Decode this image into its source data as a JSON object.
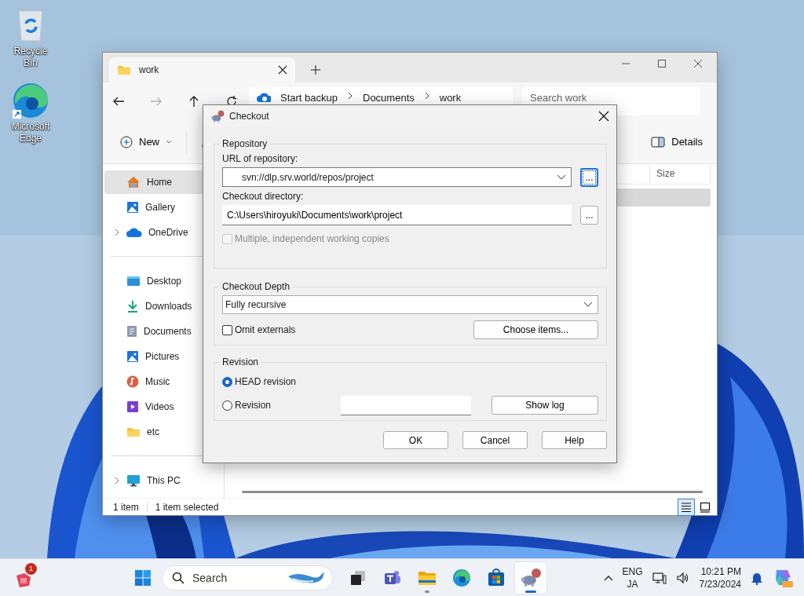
{
  "desktop_icons": [
    {
      "kind": "recycle",
      "label": "Recycle Bin"
    },
    {
      "kind": "edge",
      "label": "Microsoft Edge"
    }
  ],
  "explorer": {
    "tabs": [
      {
        "label": "work",
        "selected": true
      }
    ],
    "nav_buttons": [
      {
        "kind": "back",
        "disabled": false
      },
      {
        "kind": "forward",
        "disabled": true
      },
      {
        "kind": "up",
        "disabled": false
      },
      {
        "kind": "refresh",
        "disabled": false
      }
    ],
    "breadcrumb": [
      "Start backup",
      "Documents",
      "work"
    ],
    "search": {
      "placeholder": "Search work"
    },
    "toolbar": {
      "new": "New",
      "details": "Details"
    },
    "columns": [
      "Size"
    ],
    "files": [
      {
        "selected": true
      }
    ],
    "sidebar": [
      [
        {
          "kind": "home",
          "label": "Home",
          "selected": true,
          "expandable": false
        },
        {
          "kind": "gallery",
          "label": "Gallery",
          "selected": false,
          "expandable": false
        },
        {
          "kind": "onedrive",
          "label": "OneDrive",
          "selected": false,
          "expandable": true
        }
      ],
      [
        {
          "kind": "desktop",
          "label": "Desktop",
          "selected": false,
          "expandable": false
        },
        {
          "kind": "downloads",
          "label": "Downloads",
          "selected": false,
          "expandable": false
        },
        {
          "kind": "documents",
          "label": "Documents",
          "selected": false,
          "expandable": false
        },
        {
          "kind": "pictures",
          "label": "Pictures",
          "selected": false,
          "expandable": false
        },
        {
          "kind": "music",
          "label": "Music",
          "selected": false,
          "expandable": false
        },
        {
          "kind": "videos",
          "label": "Videos",
          "selected": false,
          "expandable": false
        },
        {
          "kind": "folder",
          "label": "etc",
          "selected": false,
          "expandable": false
        }
      ],
      [
        {
          "kind": "thispc",
          "label": "This PC",
          "selected": false,
          "expandable": true
        }
      ]
    ],
    "status_bar": [
      "1 item",
      "1 item selected"
    ],
    "views": [
      {
        "kind": "details",
        "selected": true
      },
      {
        "kind": "tiles",
        "selected": false
      }
    ]
  },
  "dialog": {
    "title": "Checkout",
    "repository": {
      "label": "Repository",
      "url_label": "URL of repository:",
      "url": "svn://dlp.srv.world/repos/project",
      "url_browse": {
        "label": "...",
        "focused": true
      },
      "dir_label": "Checkout directory:",
      "dir": "C:\\Users\\hiroyuki\\Documents\\work\\project",
      "dir_browse": {
        "label": "...",
        "focused": false
      },
      "multiple": {
        "label": "Multiple, independent working copies",
        "checked": false,
        "disabled": true
      }
    },
    "depth": {
      "label": "Checkout Depth",
      "value": "Fully recursive",
      "omit": {
        "label": "Omit externals",
        "checked": false,
        "disabled": false
      },
      "choose": "Choose items..."
    },
    "revision": {
      "label": "Revision",
      "options": [
        {
          "label": "HEAD revision",
          "selected": true
        },
        {
          "label": "Revision",
          "selected": false
        }
      ],
      "show_log": "Show log"
    },
    "buttons": [
      "OK",
      "Cancel",
      "Help"
    ]
  },
  "taskbar": {
    "widget_badge": "1",
    "search_placeholder": "Search",
    "apps": [
      {
        "kind": "taskview",
        "open": false,
        "active": false
      },
      {
        "kind": "teams",
        "open": false,
        "active": false
      },
      {
        "kind": "explorer",
        "open": true,
        "active": false
      },
      {
        "kind": "edge",
        "open": false,
        "active": false
      },
      {
        "kind": "store",
        "open": false,
        "active": false
      },
      {
        "kind": "tortoise",
        "open": true,
        "active": true
      }
    ],
    "language": [
      "ENG",
      "JA"
    ],
    "time": "10:21 PM",
    "date": "7/23/2024"
  }
}
